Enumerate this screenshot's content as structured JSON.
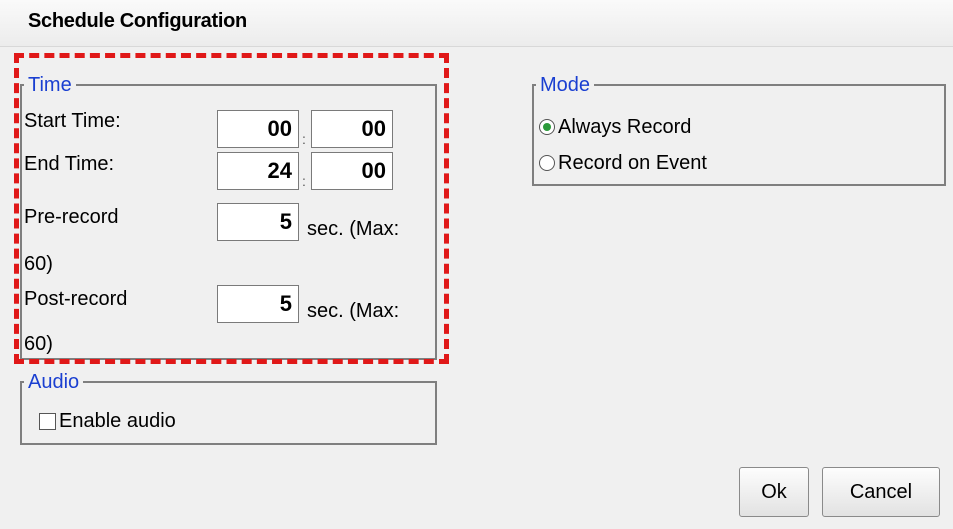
{
  "window": {
    "title": "Schedule Configuration"
  },
  "time": {
    "legend": "Time",
    "start_label": "Start Time:",
    "start_hour": "00",
    "start_minute": "00",
    "end_label": "End Time:",
    "end_hour": "24",
    "end_minute": "00",
    "separator": ":",
    "pre_label": "Pre-record",
    "pre_value": "5",
    "pre_suffix": "sec. (Max:",
    "pre_wrap": "60)",
    "post_label": "Post-record",
    "post_value": "5",
    "post_suffix": "sec. (Max:",
    "post_wrap": "60)"
  },
  "audio": {
    "legend": "Audio",
    "enable_label": "Enable audio",
    "enabled": false
  },
  "mode": {
    "legend": "Mode",
    "options": [
      {
        "label": "Always Record",
        "selected": true
      },
      {
        "label": "Record on Event",
        "selected": false
      }
    ]
  },
  "buttons": {
    "ok_label": "Ok",
    "cancel_label": "Cancel"
  },
  "colors": {
    "legend_text": "#1a3fd1",
    "highlight_border": "#e01818",
    "radio_dot": "#2b9a3a"
  }
}
